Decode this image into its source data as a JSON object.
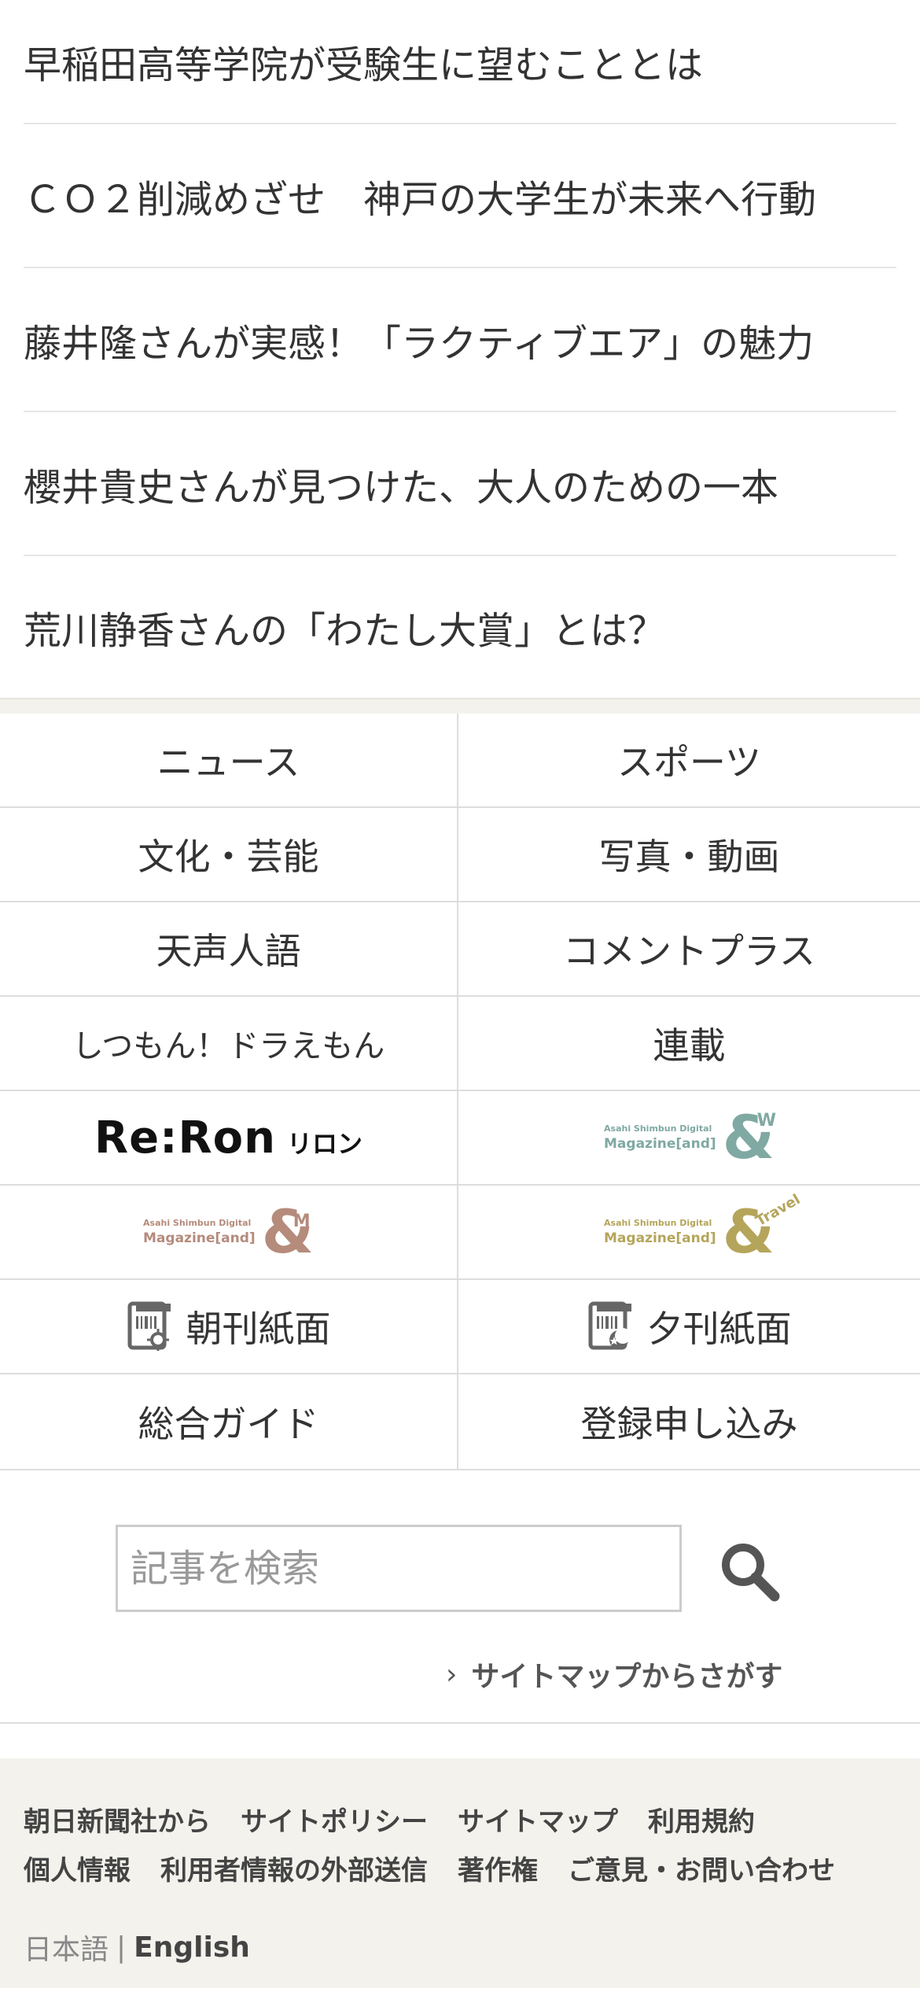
{
  "articles": [
    "早稲田高等学院が受験生に望むこととは",
    "ＣＯ２削減めざせ　神戸の大学生が未来へ行動",
    "藤井隆さんが実感！「ラクティブエア」の魅力",
    "櫻井貴史さんが見つけた、大人のための一本",
    "荒川静香さんの「わたし大賞」とは？"
  ],
  "nav": {
    "news": "ニュース",
    "sports": "スポーツ",
    "culture": "文化・芸能",
    "photo_video": "写真・動画",
    "tensei": "天声人語",
    "comment_plus": "コメントプラス",
    "doraemon": "しつもん！ドラえもん",
    "rensai": "連載",
    "reron_main": "Re:Ron",
    "reron_kana": "リロン",
    "mag_sub": "Asahi Shimbun Digital",
    "mag_main": "Magazine[and]",
    "andw_tag": "W",
    "andm_tag": "M",
    "andtravel_tag": "Travel",
    "morning_paper": "朝刊紙面",
    "evening_paper": "夕刊紙面",
    "guide": "総合ガイド",
    "register": "登録申し込み"
  },
  "search": {
    "placeholder": "記事を検索",
    "sitemap_link": "サイトマップからさがす"
  },
  "footer": {
    "links": [
      "朝日新聞社から",
      "サイトポリシー",
      "サイトマップ",
      "利用規約",
      "個人情報",
      "利用者情報の外部送信",
      "著作権",
      "ご意見・お問い合わせ"
    ],
    "lang_ja": "日本語",
    "lang_sep": "|",
    "lang_en": "English"
  },
  "colors": {
    "andw": "#7fa9a2",
    "andm": "#b58b7c",
    "andtravel": "#b5a55b",
    "footer_bg": "#f3f2ed"
  }
}
